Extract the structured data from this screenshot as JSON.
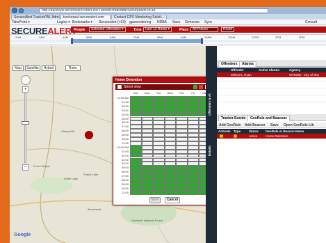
{
  "browser": {
    "address": "http://trackeyal.securealert.com/Flex/TrackerPortal/html/SecureAlert.cn.48",
    "tabs": [
      "SecureAlert TrackerPAL Admin...",
      "trackerpal.securealert.com",
      "Contact GPS Monitoring Soluti..."
    ],
    "favorites": [
      "TakePoint ▾",
      "Logins ▾",
      "Bookmarks ▾",
      "Securealert (>33)",
      "gpsmonitoring",
      "NDBA",
      "Save",
      "Generate",
      "Sync",
      "Consult"
    ]
  },
  "app": {
    "logo_part1": "SECURE",
    "logo_part2": "ALERT",
    "logo_sub": "Ver 5.0.0627",
    "filters": {
      "people_label": "People",
      "people_value": "Selected Offenders ▾",
      "time_label": "Time",
      "time_value": "Last 13 Hours ▾",
      "place_label": "Place",
      "place_value": "All Places",
      "reset_label": "Reset"
    },
    "timeline_labels": [
      "2AM",
      "3AM",
      "4AM",
      "5AM",
      "6AM",
      "7AM",
      "8AM",
      "9AM",
      "10AM",
      "11AM",
      "12PM",
      "1PM",
      "2PM"
    ]
  },
  "map": {
    "types": [
      "Map",
      "Satellite",
      "Hybrid",
      "Ruler"
    ],
    "labels": [
      "Fenn Canyon",
      "Cherry Hill",
      "White Lake",
      "Prairie Lake",
      "Arrowhead",
      "Sawtooth National Forest"
    ],
    "logo": "Google",
    "marker_icon": "offender-marker-icon"
  },
  "dialog": {
    "title": "Home Detention",
    "subtitle": "Street view",
    "days": [
      "Sun",
      "Mon",
      "Tue",
      "Wed",
      "Thu",
      "Fri",
      "Sat"
    ],
    "hours": [
      "12:00 AM",
      "01:00",
      "02:00",
      "03:00",
      "04:00",
      "05:00",
      "06:00",
      "07:00",
      "08:00",
      "09:00",
      "10:00",
      "11:00",
      "12:00 PM",
      "01:00",
      "02:00",
      "03:00",
      "04:00",
      "05:00",
      "06:00",
      "07:00",
      "08:00",
      "09:00",
      "10:00",
      "11:00"
    ],
    "save_label": "Save",
    "cancel_label": "Cancel"
  },
  "side": {
    "vtab1": "Offenders & At",
    "vtab2": "Details"
  },
  "panel": {
    "tabs": [
      "Offenders",
      "Alarms"
    ],
    "offender_headers": [
      "Offender",
      "Active Alarms",
      "Agency"
    ],
    "offender_row": {
      "name": "Williams, Ryan",
      "alarms": "",
      "agency": "GPS005 - City of Sho"
    },
    "lower_tabs": [
      "Tracker Events",
      "GeoRule and Beacons"
    ],
    "toolbar": [
      "Add GeoRule",
      "Add Beacon",
      "Save",
      "Open GeoRule Lib"
    ],
    "rule_headers": [
      "Activate",
      "Type",
      "Status",
      "GeoRule or Beacon Name"
    ],
    "rule_row": {
      "status": "Active",
      "name": "Home Detention"
    }
  },
  "colors": {
    "accent_red": "#b40d0d",
    "on_green": "#23b023",
    "desktop_orange": "#e26a1a"
  }
}
